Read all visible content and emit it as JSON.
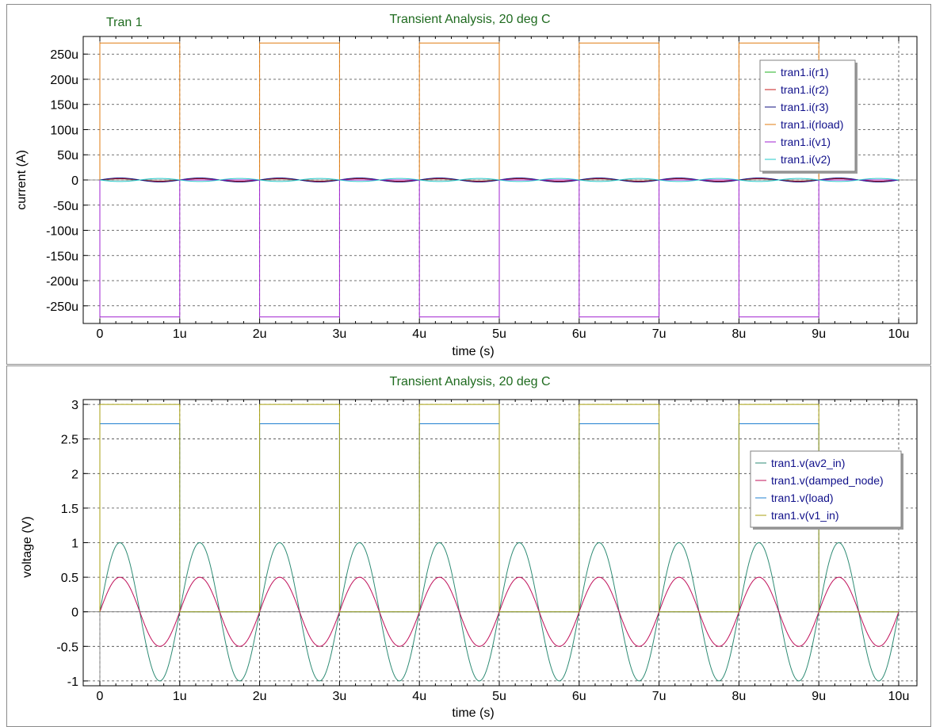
{
  "window": {
    "panel_tag": "Tran 1"
  },
  "chart_data": [
    {
      "type": "line",
      "title": "Transient Analysis, 20 deg C",
      "xlabel": "time (s)",
      "ylabel": "current (A)",
      "xlim": [
        0,
        1e-05
      ],
      "ylim": [
        -0.000285,
        0.000285
      ],
      "grid": true,
      "legend_position": "top-right",
      "x_ticks": [
        {
          "v": 0,
          "label": "0"
        },
        {
          "v": 1e-06,
          "label": "1u"
        },
        {
          "v": 2e-06,
          "label": "2u"
        },
        {
          "v": 3e-06,
          "label": "3u"
        },
        {
          "v": 4e-06,
          "label": "4u"
        },
        {
          "v": 5e-06,
          "label": "5u"
        },
        {
          "v": 6e-06,
          "label": "6u"
        },
        {
          "v": 7e-06,
          "label": "7u"
        },
        {
          "v": 8e-06,
          "label": "8u"
        },
        {
          "v": 9e-06,
          "label": "9u"
        },
        {
          "v": 1e-05,
          "label": "10u"
        }
      ],
      "y_ticks": [
        {
          "v": 0.00025,
          "label": "250u"
        },
        {
          "v": 0.0002,
          "label": "200u"
        },
        {
          "v": 0.00015,
          "label": "150u"
        },
        {
          "v": 0.0001,
          "label": "100u"
        },
        {
          "v": 5e-05,
          "label": "50u"
        },
        {
          "v": 0,
          "label": "0"
        },
        {
          "v": -5e-05,
          "label": "-50u"
        },
        {
          "v": -0.0001,
          "label": "-100u"
        },
        {
          "v": -0.00015,
          "label": "-150u"
        },
        {
          "v": -0.0002,
          "label": "-200u"
        },
        {
          "v": -0.00025,
          "label": "-250u"
        }
      ],
      "series": [
        {
          "name": "tran1.i(r1)",
          "color": "#22b022",
          "kind": "sine",
          "amplitude": 2.5e-06,
          "period": 1e-06,
          "phase": 0
        },
        {
          "name": "tran1.i(r2)",
          "color": "#c81e1e",
          "kind": "sine",
          "amplitude": 2.5e-06,
          "period": 1e-06,
          "phase": 0
        },
        {
          "name": "tran1.i(r3)",
          "color": "#101080",
          "kind": "sine",
          "amplitude": 4e-06,
          "period": 1e-06,
          "phase": 0
        },
        {
          "name": "tran1.i(rload)",
          "color": "#e07b10",
          "kind": "square",
          "high": 0.000272,
          "low": 0,
          "period": 2e-06,
          "duty": 0.5,
          "end": 9e-06
        },
        {
          "name": "tran1.i(v1)",
          "color": "#a020d0",
          "kind": "square",
          "high": -0.000272,
          "low": 0,
          "period": 2e-06,
          "duty": 0.5,
          "end": 9e-06
        },
        {
          "name": "tran1.i(v2)",
          "color": "#20c8c8",
          "kind": "sine",
          "amplitude": -3e-06,
          "period": 1e-06,
          "phase": 0
        }
      ]
    },
    {
      "type": "line",
      "title": "Transient Analysis, 20 deg C",
      "xlabel": "time (s)",
      "ylabel": "voltage (V)",
      "xlim": [
        0,
        1e-05
      ],
      "ylim": [
        -1.07,
        3.07
      ],
      "grid": true,
      "legend_position": "right",
      "x_ticks": [
        {
          "v": 0,
          "label": "0"
        },
        {
          "v": 1e-06,
          "label": "1u"
        },
        {
          "v": 2e-06,
          "label": "2u"
        },
        {
          "v": 3e-06,
          "label": "3u"
        },
        {
          "v": 4e-06,
          "label": "4u"
        },
        {
          "v": 5e-06,
          "label": "5u"
        },
        {
          "v": 6e-06,
          "label": "6u"
        },
        {
          "v": 7e-06,
          "label": "7u"
        },
        {
          "v": 8e-06,
          "label": "8u"
        },
        {
          "v": 9e-06,
          "label": "9u"
        },
        {
          "v": 1e-05,
          "label": "10u"
        }
      ],
      "y_ticks": [
        {
          "v": 3,
          "label": "3"
        },
        {
          "v": 2.5,
          "label": "2.5"
        },
        {
          "v": 2,
          "label": "2"
        },
        {
          "v": 1.5,
          "label": "1.5"
        },
        {
          "v": 1,
          "label": "1"
        },
        {
          "v": 0.5,
          "label": "0.5"
        },
        {
          "v": 0,
          "label": "0"
        },
        {
          "v": -0.5,
          "label": "-0.5"
        },
        {
          "v": -1,
          "label": "-1"
        }
      ],
      "series": [
        {
          "name": "tran1.v(av2_in)",
          "color": "#2e8b74",
          "kind": "sine",
          "amplitude": 1,
          "period": 1e-06,
          "phase": 0
        },
        {
          "name": "tran1.v(damped_node)",
          "color": "#c0105a",
          "kind": "sine",
          "amplitude": 0.5,
          "period": 1e-06,
          "phase": 0
        },
        {
          "name": "tran1.v(load)",
          "color": "#2080d0",
          "kind": "square",
          "high": 2.72,
          "low": 0,
          "period": 2e-06,
          "duty": 0.5,
          "end": 9e-06
        },
        {
          "name": "tran1.v(v1_in)",
          "color": "#a8a010",
          "kind": "square",
          "high": 3,
          "low": 0,
          "period": 2e-06,
          "duty": 0.5,
          "end": 9e-06
        }
      ]
    }
  ],
  "colors": {
    "title": "#1f6b1f",
    "legend_text": "#10108a",
    "grid": "#555555"
  }
}
